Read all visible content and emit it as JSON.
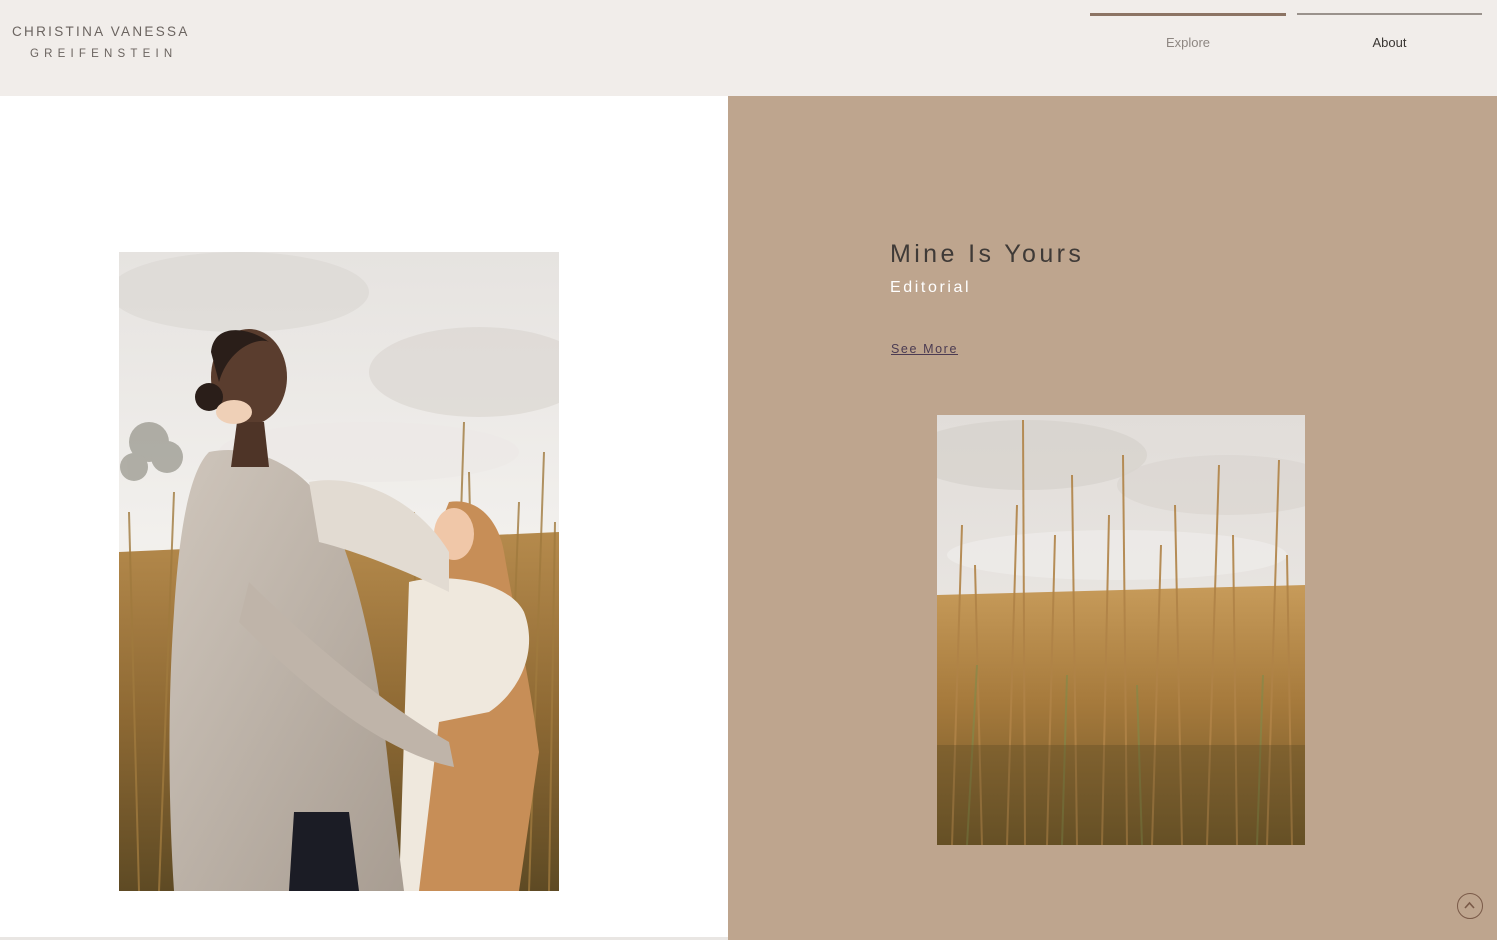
{
  "brand": {
    "name_line1": "CHRISTINA VANESSA",
    "name_line2": "GREIFENSTEIN"
  },
  "nav": {
    "items": [
      {
        "label": "Explore",
        "active": true
      },
      {
        "label": "About",
        "active": false
      }
    ]
  },
  "feature": {
    "title": "Mine Is Yours",
    "subtitle": "Editorial",
    "link_label": "See More"
  },
  "images": {
    "main": "two-models-in-sweaters-among-tall-grass",
    "secondary": "golden-tall-grass-field-under-cloudy-sky"
  },
  "icons": {
    "scroll_top": "chevron-up-circle-icon"
  },
  "colors": {
    "header_bg": "#f1edea",
    "panel_tan": "#bea58e",
    "nav_active_bar": "#8c7464",
    "title_text": "#3f3a37",
    "link_text": "#4b3b52"
  }
}
